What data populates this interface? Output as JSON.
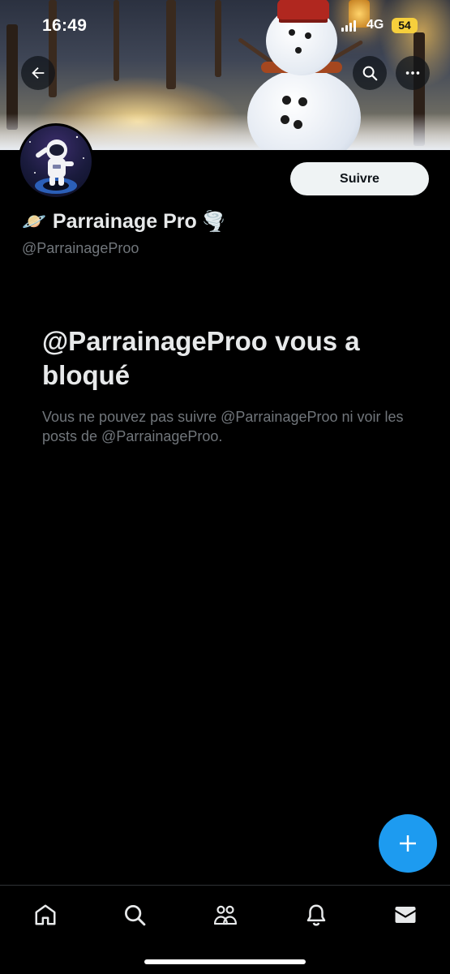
{
  "status_bar": {
    "time": "16:49",
    "network": "4G",
    "battery": "54"
  },
  "header": {
    "back_icon": "arrow-left-icon",
    "search_icon": "search-icon",
    "more_icon": "more-horizontal-icon"
  },
  "profile": {
    "display_name": "Parrainage Pro",
    "name_prefix_emoji": "🪐",
    "name_suffix_emoji": "🌪️",
    "handle": "@ParrainageProo",
    "follow_label": "Suivre"
  },
  "blocked": {
    "title": "@ParrainageProo vous a bloqué",
    "description": "Vous ne pouvez pas suivre @ParrainageProo ni voir les posts de @ParrainageProo."
  },
  "fab": {
    "icon": "plus-icon"
  },
  "bottom_nav": {
    "items": [
      {
        "icon": "home-icon"
      },
      {
        "icon": "search-icon"
      },
      {
        "icon": "communities-icon"
      },
      {
        "icon": "bell-icon"
      },
      {
        "icon": "mail-icon"
      }
    ]
  },
  "colors": {
    "background": "#000000",
    "text_primary": "#e7e9ea",
    "text_secondary": "#71767b",
    "accent": "#1d9bf0",
    "follow_button_bg": "#eff3f4",
    "battery": "#f6cf3c"
  }
}
